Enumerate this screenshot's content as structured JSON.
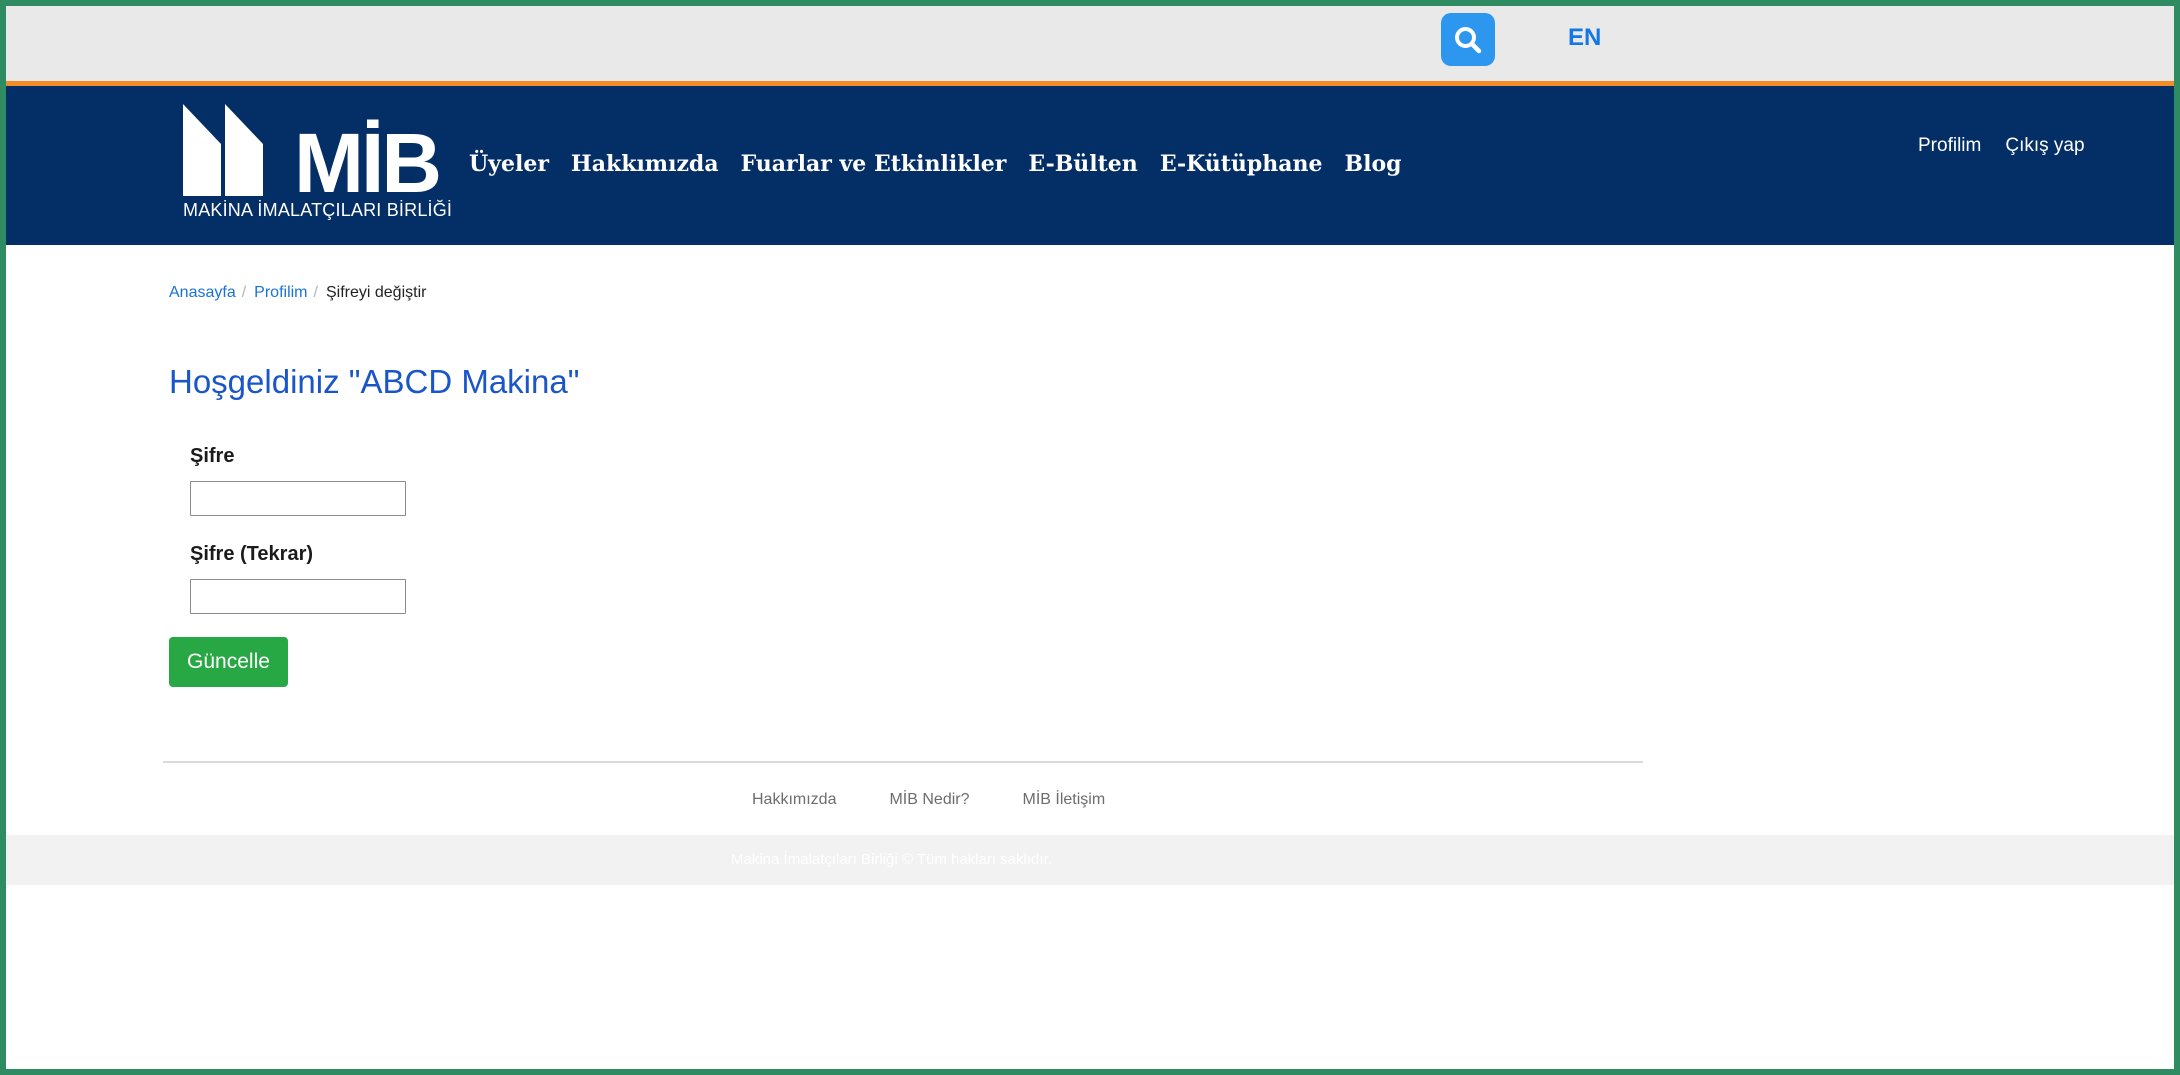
{
  "colors": {
    "frame": "#2e8b62",
    "topbar": "#e9e9e9",
    "accent_line": "#f28c28",
    "navbar": "#042e66",
    "search_button": "#2d97f0",
    "link": "#1a73d9",
    "title": "#1a56c9",
    "submit": "#28a745"
  },
  "topbar": {
    "search_icon": "search-icon",
    "language_label": "EN"
  },
  "logo": {
    "wordmark": "MİB",
    "subtitle": "MAKİNA İMALATÇILARI BİRLİĞİ"
  },
  "nav": {
    "items": [
      {
        "label": "Üyeler"
      },
      {
        "label": "Hakkımızda"
      },
      {
        "label": "Fuarlar ve Etkinlikler"
      },
      {
        "label": "E-Bülten"
      },
      {
        "label": "E-Kütüphane"
      },
      {
        "label": "Blog"
      }
    ],
    "profile_label": "Profilim",
    "logout_label": "Çıkış yap"
  },
  "breadcrumb": {
    "items": [
      "Anasayfa",
      "Profilim"
    ],
    "current": "Şifreyi değiştir"
  },
  "main": {
    "title": "Hoşgeldiniz \"ABCD Makina\"",
    "password_label": "Şifre",
    "password_value": "",
    "password_repeat_label": "Şifre (Tekrar)",
    "password_repeat_value": "",
    "submit_label": "Güncelle"
  },
  "footer": {
    "links": [
      "Hakkımızda",
      "MİB Nedir?",
      "MİB İletişim"
    ],
    "copyright": "Makina İmalatçıları Birliği © Tüm hakları saklıdır."
  }
}
